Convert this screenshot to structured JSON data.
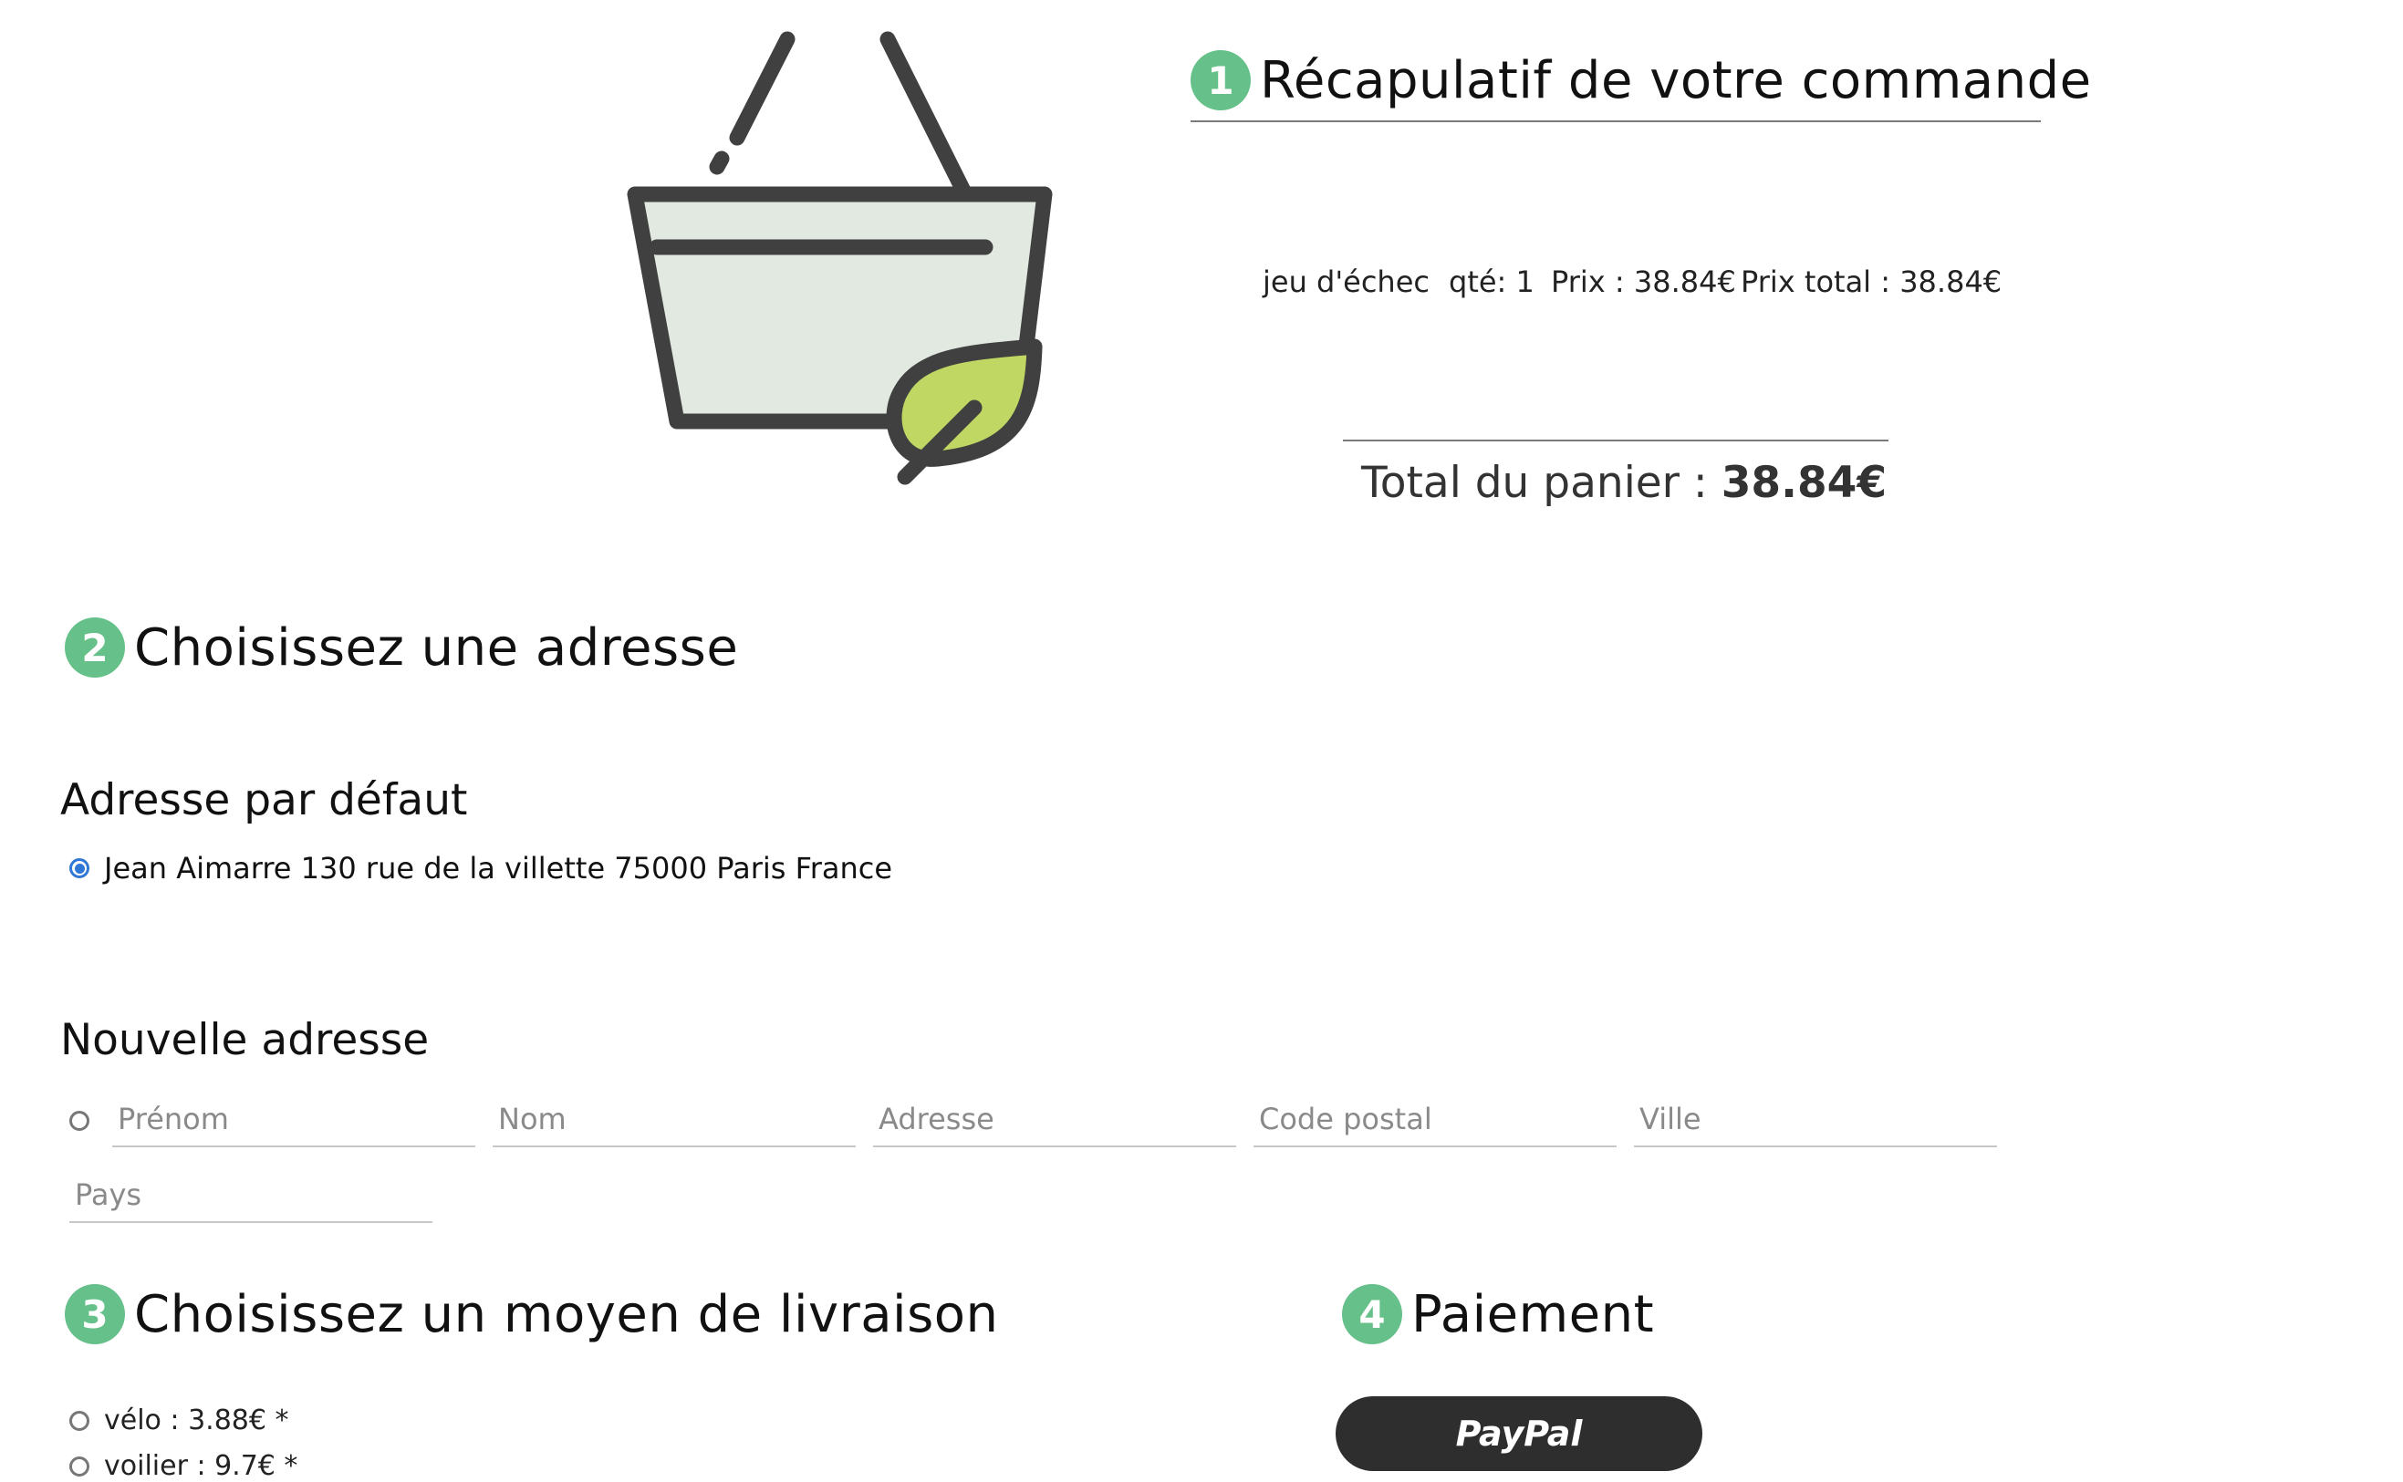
{
  "summary": {
    "step": "1",
    "title": "Récapulatif de votre commande",
    "item": {
      "name": "jeu d'échec",
      "qty": "qté: 1",
      "price": "Prix : 38.84€",
      "total": "Prix total : 38.84€"
    },
    "total_label": "Total du panier :",
    "total_value": "38.84€"
  },
  "address": {
    "step": "2",
    "title": "Choisissez une adresse",
    "default_heading": "Adresse par défaut",
    "default_value": "Jean Aimarre 130 rue de la villette 75000 Paris France",
    "new_heading": "Nouvelle adresse",
    "fields": {
      "prenom": "Prénom",
      "nom": "Nom",
      "adresse": "Adresse",
      "code_postal": "Code postal",
      "ville": "Ville",
      "pays": "Pays"
    }
  },
  "delivery": {
    "step": "3",
    "title": "Choisissez un moyen de livraison",
    "options": [
      "vélo : 3.88€ *",
      "voilier : 9.7€ *"
    ]
  },
  "payment": {
    "step": "4",
    "title": "Paiement",
    "paypal_label": "PayPal"
  },
  "colors": {
    "badge": "#66c08a",
    "basket_fill": "#e1e9e1",
    "leaf": "#c0d764",
    "outline": "#404040",
    "radio_checked": "#2f78d6",
    "paypal_button": "#2e2e2e"
  },
  "icons": [
    "basket-leaf-icon",
    "radio-checked-icon",
    "radio-unchecked-icon"
  ]
}
